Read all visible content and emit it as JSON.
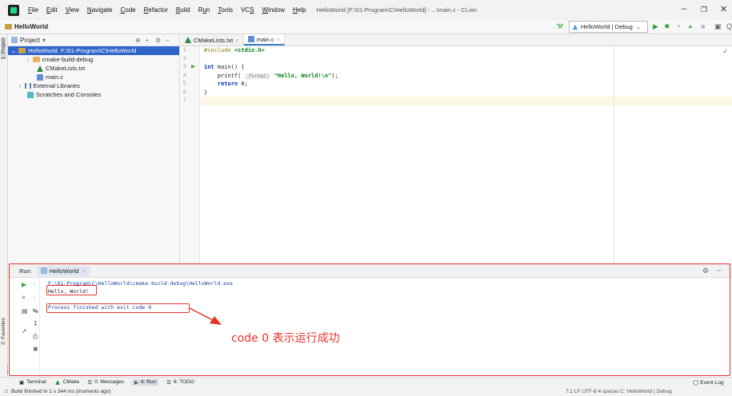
{
  "menubar": {
    "items": [
      {
        "label": "File",
        "mn": "F"
      },
      {
        "label": "Edit",
        "mn": "E"
      },
      {
        "label": "View",
        "mn": "V"
      },
      {
        "label": "Navigate",
        "mn": "N"
      },
      {
        "label": "Code",
        "mn": "C"
      },
      {
        "label": "Refactor",
        "mn": "R"
      },
      {
        "label": "Build",
        "mn": "B"
      },
      {
        "label": "Run",
        "mn": "u"
      },
      {
        "label": "Tools",
        "mn": "T"
      },
      {
        "label": "VCS",
        "mn": "S"
      },
      {
        "label": "Window",
        "mn": "W"
      },
      {
        "label": "Help",
        "mn": "H"
      }
    ],
    "title": "HelloWorld [F:\\01-Program\\C\\HelloWorld] - ...\\main.c - CLion"
  },
  "navbar": {
    "breadcrumb": "HelloWorld",
    "run_config": "HelloWorld | Debug"
  },
  "stripe": {
    "project_tab": "1: Project",
    "favorites_tab": "2: Favorites",
    "structure_tab": "Z: Structure"
  },
  "project": {
    "header": "Project",
    "tree": [
      {
        "label": "HelloWorld",
        "path": "F:\\01-Program\\C\\HelloWorld",
        "selected": true
      },
      {
        "label": "cmake-build-debug"
      },
      {
        "label": "CMakeLists.txt"
      },
      {
        "label": "main.c"
      },
      {
        "label": "External Libraries"
      },
      {
        "label": "Scratches and Consoles"
      }
    ]
  },
  "editor": {
    "tabs": [
      {
        "label": "CMakeLists.txt",
        "active": false
      },
      {
        "label": "main.c",
        "active": true
      }
    ],
    "line_numbers": [
      "1",
      "2",
      "3",
      "4",
      "5",
      "6",
      "7"
    ],
    "code": {
      "l1_kw": "#include",
      "l1_hdr": "<stdio.h>",
      "l3_kw": "int",
      "l3_rest": " main() {",
      "l4_fn": "    printf(",
      "l4_hint": "_Format:",
      "l4_str": "\"Hello, World!\\n\"",
      "l4_end": ");",
      "l5_kw": "return",
      "l5_rest": " 0;",
      "l6": "}"
    }
  },
  "run_panel": {
    "label": "Run:",
    "tab": "HelloWorld",
    "console": {
      "path": "F:\\01-Program\\C\\HelloWorld\\cmake-build-debug\\HelloWorld.exe",
      "output": "Hello, World!",
      "exit": "Process finished with exit code 0"
    },
    "annotation": "code 0 表示运行成功"
  },
  "bottom_tabs": [
    {
      "label": "Terminal",
      "active": false
    },
    {
      "label": "CMake",
      "active": false
    },
    {
      "label": "0: Messages",
      "active": false
    },
    {
      "label": "4: Run",
      "active": true
    },
    {
      "label": "6: TODO",
      "active": false
    }
  ],
  "event_log": "Event Log",
  "statusbar": {
    "left": "Build finished in 1 s 344 ms (moments ago)",
    "right": "7:1  LF  UTF-8  4 spaces  C: HelloWorld | Debug"
  },
  "colors": {
    "accent": "#2f65ca",
    "annotation_red": "#e8322c",
    "run_green": "#3aa33a"
  }
}
